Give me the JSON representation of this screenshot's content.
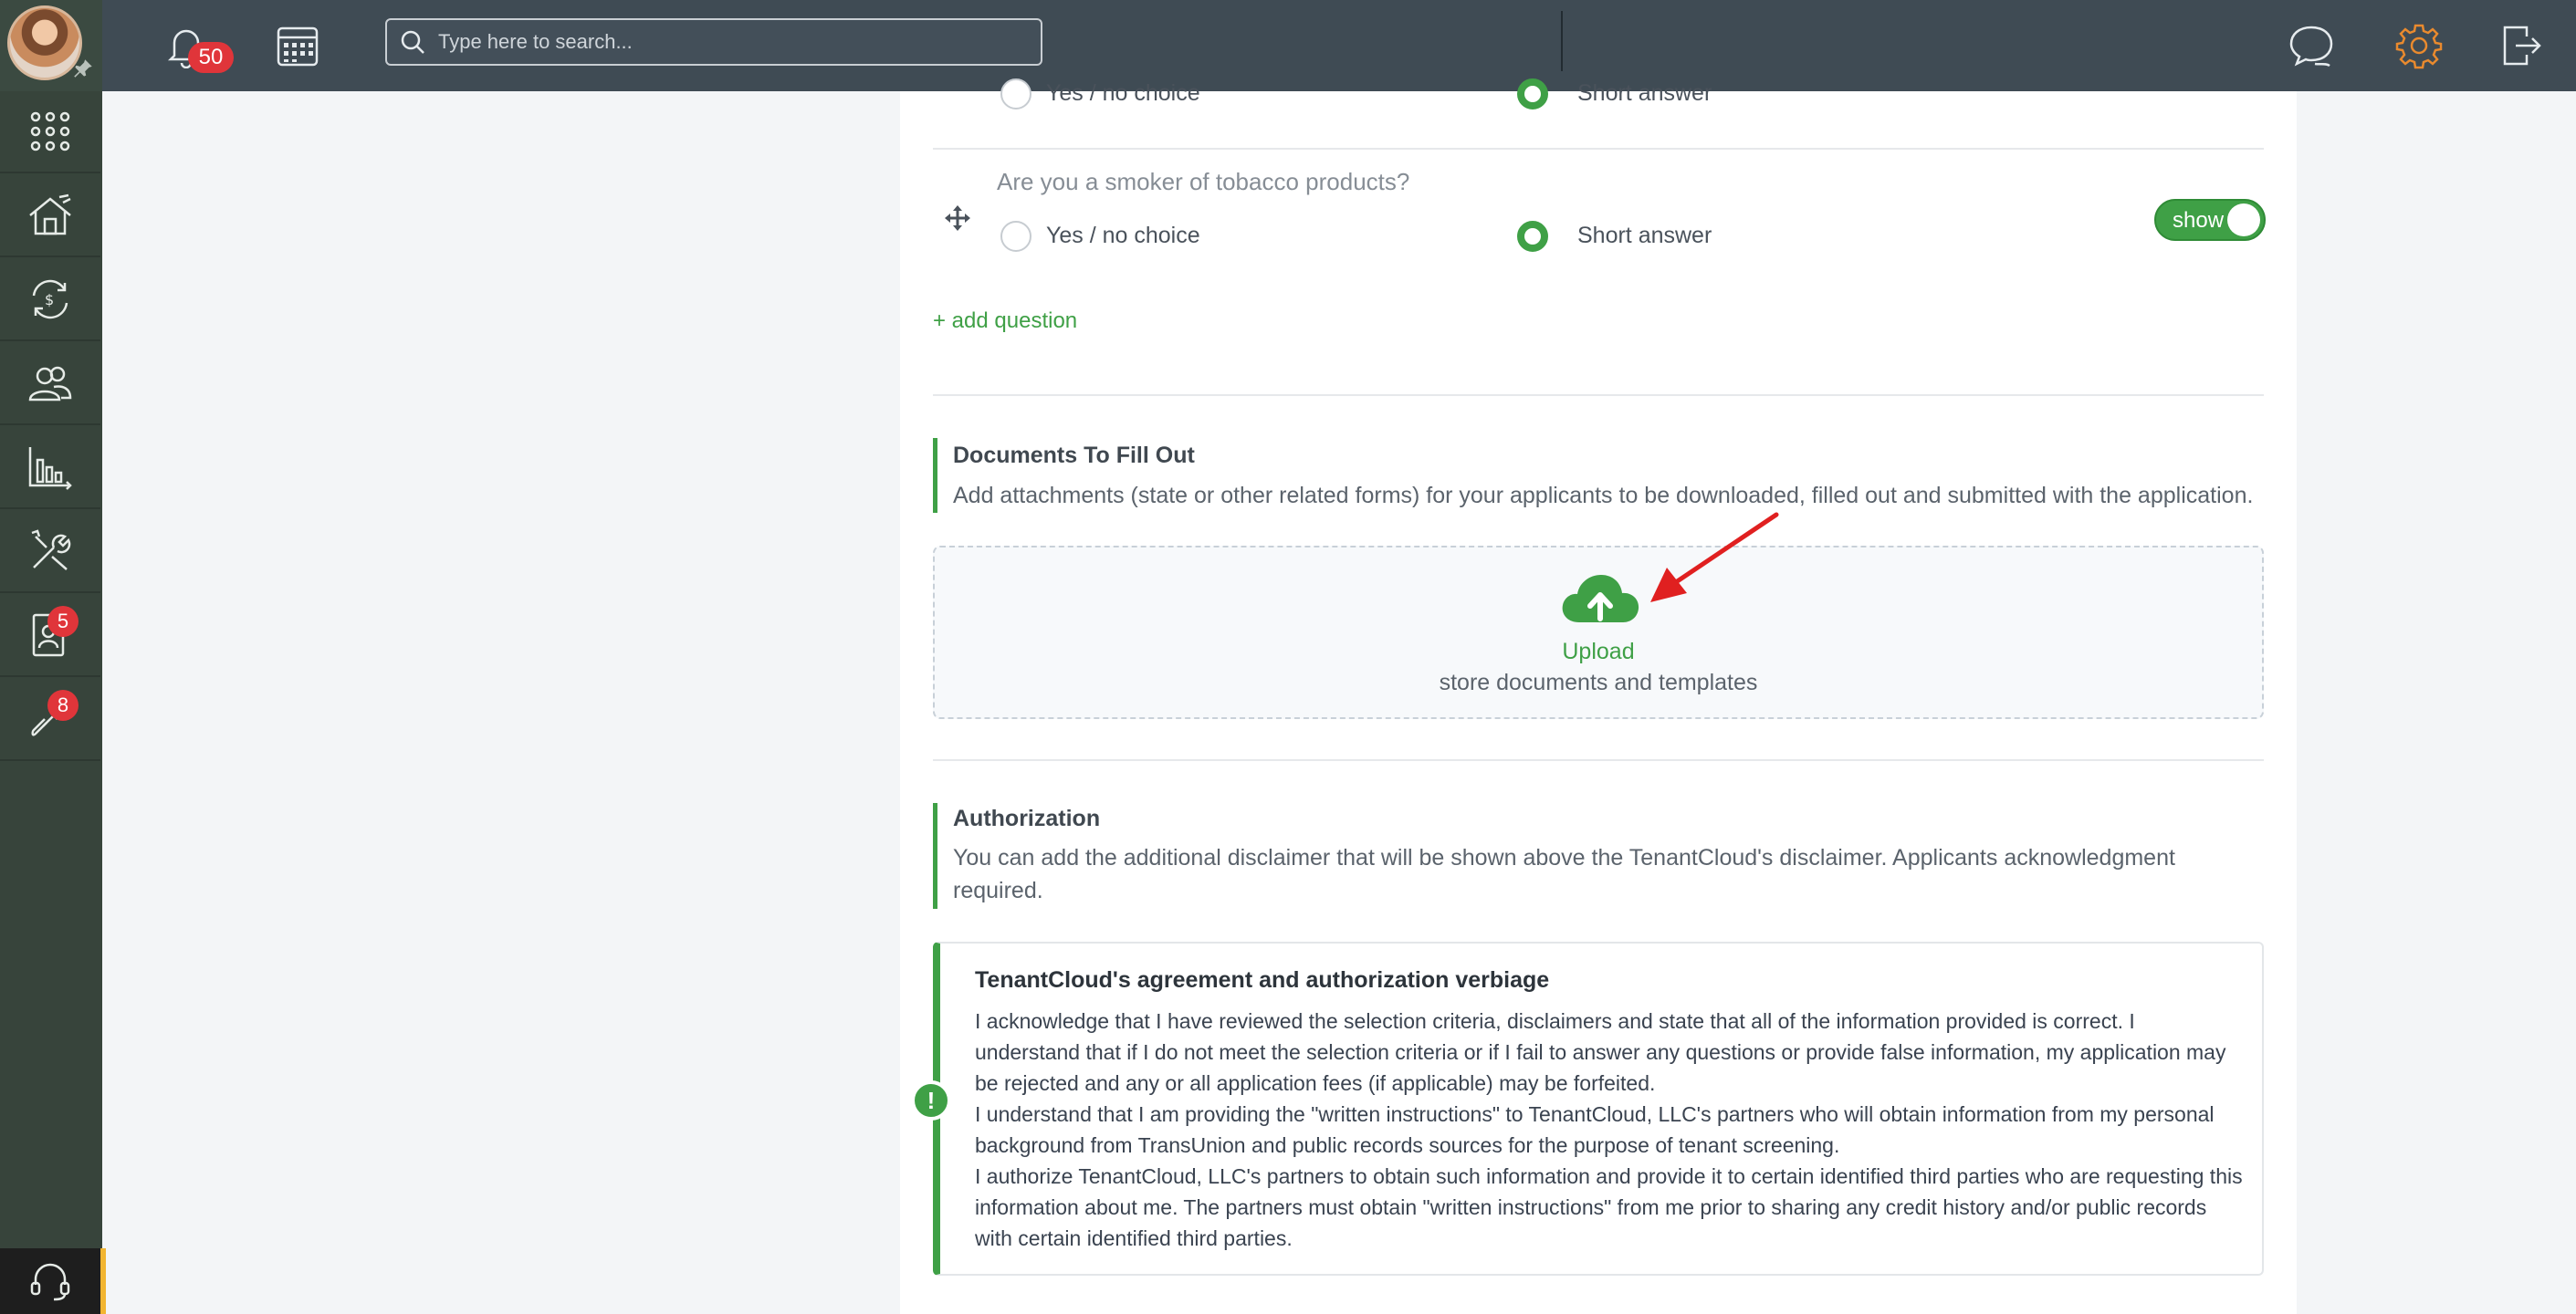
{
  "topbar": {
    "notifications_count": "50",
    "search_placeholder": "Type here to search..."
  },
  "sidebar": {
    "items": [
      {
        "name": "apps",
        "icon": "grid-icon"
      },
      {
        "name": "properties",
        "icon": "house-icon"
      },
      {
        "name": "accounting",
        "icon": "money-cycle-icon"
      },
      {
        "name": "contacts",
        "icon": "people-icon"
      },
      {
        "name": "reports",
        "icon": "chart-icon"
      },
      {
        "name": "maintenance",
        "icon": "tools-icon"
      },
      {
        "name": "applications",
        "icon": "person-doc-icon",
        "badge": "5"
      },
      {
        "name": "integrations",
        "icon": "link-icon",
        "badge": "8"
      }
    ]
  },
  "questions": [
    {
      "text": "",
      "option_a": "Yes / no choice",
      "option_b": "Short answer",
      "selected": "b"
    },
    {
      "text": "Are you a smoker of tobacco products?",
      "option_a": "Yes / no choice",
      "option_b": "Short answer",
      "selected": "b",
      "toggle": "show"
    }
  ],
  "add_question": "+ add question",
  "documents": {
    "title": "Documents To Fill Out",
    "description": "Add attachments (state or other related forms) for your applicants to be downloaded, filled out and submitted with the application.",
    "upload_label": "Upload",
    "upload_sub": "store documents and templates"
  },
  "authorization": {
    "title": "Authorization",
    "description": "You can add the additional disclaimer that will be shown above the TenantCloud's disclaimer. Applicants acknowledgment required."
  },
  "agreement": {
    "title": "TenantCloud's agreement and authorization verbiage",
    "lines": [
      "I acknowledge that I have reviewed the selection criteria, disclaimers and state that all of the information provided is correct. I understand that if I do not meet the selection criteria or if I fail to answer any questions or provide false information, my application may be rejected and any or all application fees (if applicable) may be forfeited.",
      "I understand that I am providing the \"written instructions\" to TenantCloud, LLC's partners who will obtain information from my personal background from TransUnion and public records sources for the purpose of tenant screening.",
      "I authorize TenantCloud, LLC's partners to obtain such information and provide it to certain identified third parties who are requesting this information about me. The partners must obtain \"written instructions\" from me prior to sharing any credit history and/or public records with certain identified third parties."
    ]
  },
  "colors": {
    "accent": "#3fa046",
    "topbar": "#3f4b54",
    "sidebar": "#37443b",
    "badge": "#e0353a",
    "gear": "#e98a2e"
  }
}
